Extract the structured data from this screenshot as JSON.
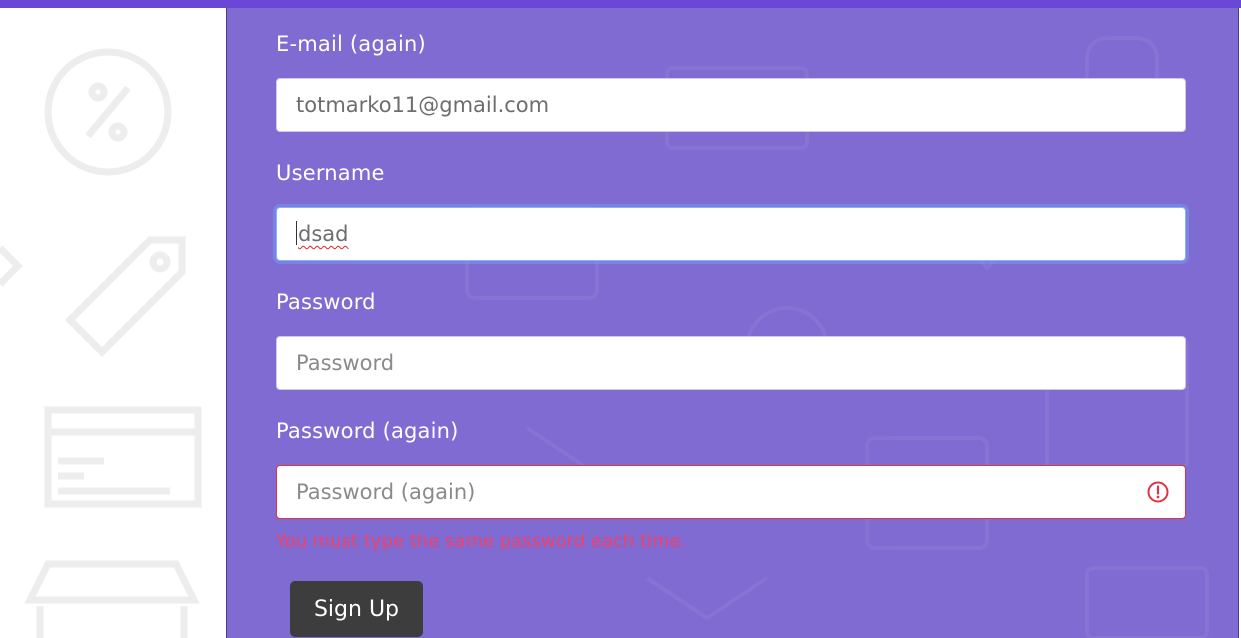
{
  "form": {
    "email_again": {
      "label": "E-mail (again)",
      "value": "totmarko11@gmail.com"
    },
    "username": {
      "label": "Username",
      "value": "dsad"
    },
    "password": {
      "label": "Password",
      "placeholder": "Password"
    },
    "password_again": {
      "label": "Password (again)",
      "placeholder": "Password (again)",
      "error": "You must type the same password each time."
    },
    "submit_label": "Sign Up"
  },
  "colors": {
    "top_bar": "#6a47d6",
    "panel": "#7f6bd1",
    "error": "#f0416c",
    "button": "#3d3d3d"
  }
}
